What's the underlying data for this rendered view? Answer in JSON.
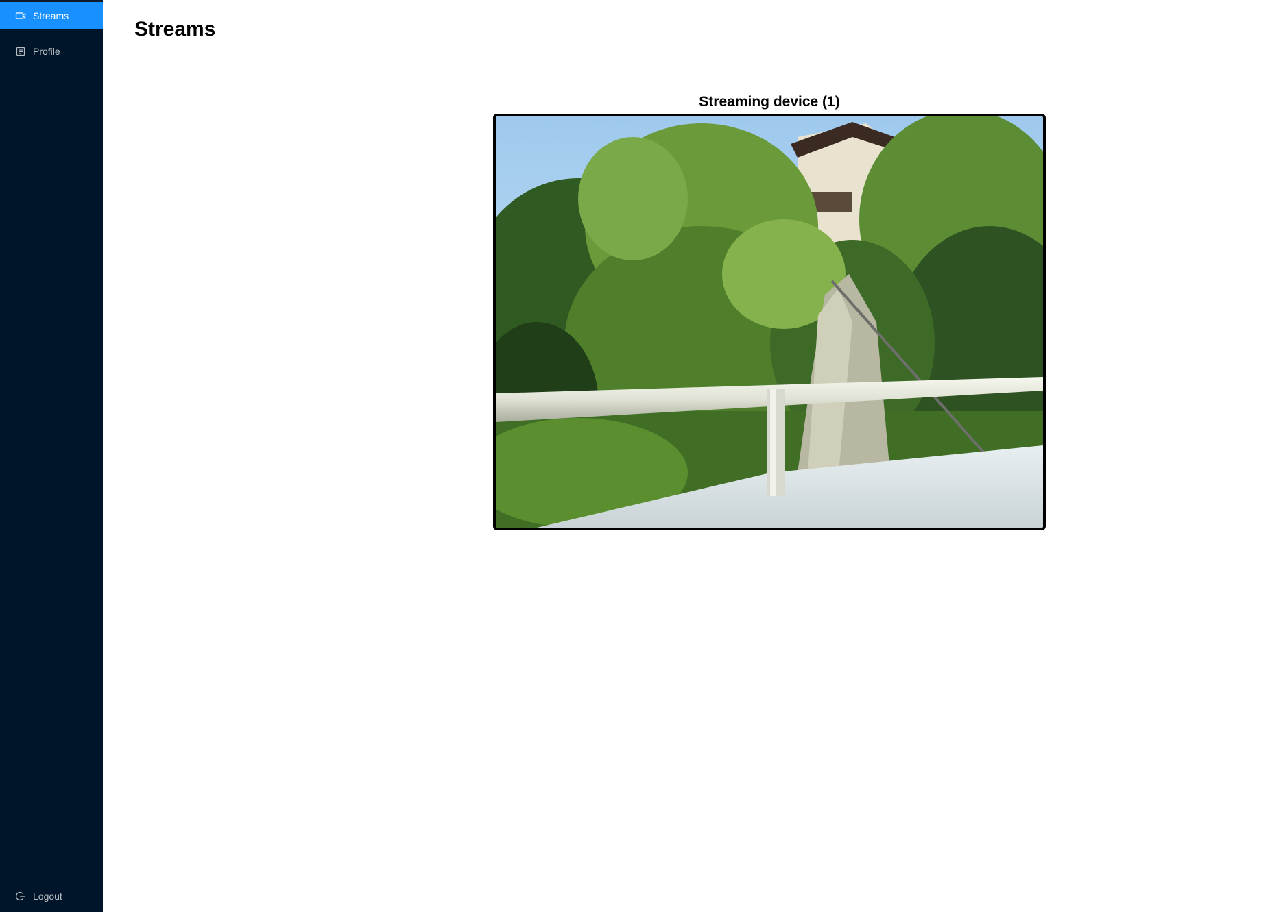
{
  "sidebar": {
    "items": [
      {
        "label": "Streams",
        "icon": "video-camera-icon",
        "active": true
      },
      {
        "label": "Profile",
        "icon": "profile-icon",
        "active": false
      }
    ],
    "logout": {
      "label": "Logout",
      "icon": "logout-icon"
    }
  },
  "page": {
    "title": "Streams"
  },
  "streams": [
    {
      "title": "Streaming device (1)"
    }
  ],
  "colors": {
    "sidebar_bg": "#001529",
    "active_item": "#1890ff",
    "frame_border": "#000000"
  }
}
